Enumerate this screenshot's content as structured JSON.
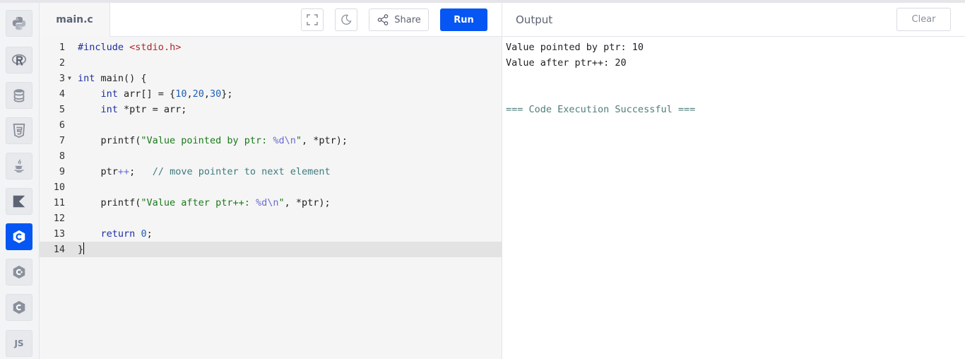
{
  "sidebar": {
    "languages": [
      {
        "name": "python-icon",
        "active": false
      },
      {
        "name": "r-icon",
        "active": false
      },
      {
        "name": "database-icon",
        "active": false
      },
      {
        "name": "html5-icon",
        "active": false
      },
      {
        "name": "java-icon",
        "active": false
      },
      {
        "name": "kotlin-icon",
        "active": false
      },
      {
        "name": "c-icon",
        "active": true
      },
      {
        "name": "cpp-icon",
        "active": false
      },
      {
        "name": "csharp-icon",
        "active": false
      },
      {
        "name": "javascript-icon",
        "active": false,
        "label": "JS"
      }
    ]
  },
  "editor": {
    "file_tab": "main.c",
    "share_label": "Share",
    "run_label": "Run",
    "line_numbers": [
      "1",
      "2",
      "3",
      "4",
      "5",
      "6",
      "7",
      "8",
      "9",
      "10",
      "11",
      "12",
      "13",
      "14"
    ],
    "current_line": "14",
    "code_lines": [
      "#include <stdio.h>",
      "",
      "int main() {",
      "    int arr[] = {10,20,30};",
      "    int *ptr = arr;",
      "",
      "    printf(\"Value pointed by ptr: %d\\n\", *ptr);",
      "",
      "    ptr++;   // move pointer to next element",
      "",
      "    printf(\"Value after ptr++: %d\\n\", *ptr);",
      "",
      "    return 0;",
      "}"
    ]
  },
  "output": {
    "title": "Output",
    "clear_label": "Clear",
    "lines": [
      "Value pointed by ptr: 10",
      "Value after ptr++: 20",
      "",
      "",
      "=== Code Execution Successful ==="
    ]
  },
  "colors": {
    "accent": "#0556f3",
    "keyword": "#1d2fa3",
    "string": "#1a7a1a",
    "comment": "#3f7a7e",
    "success": "#4e7e7a"
  }
}
